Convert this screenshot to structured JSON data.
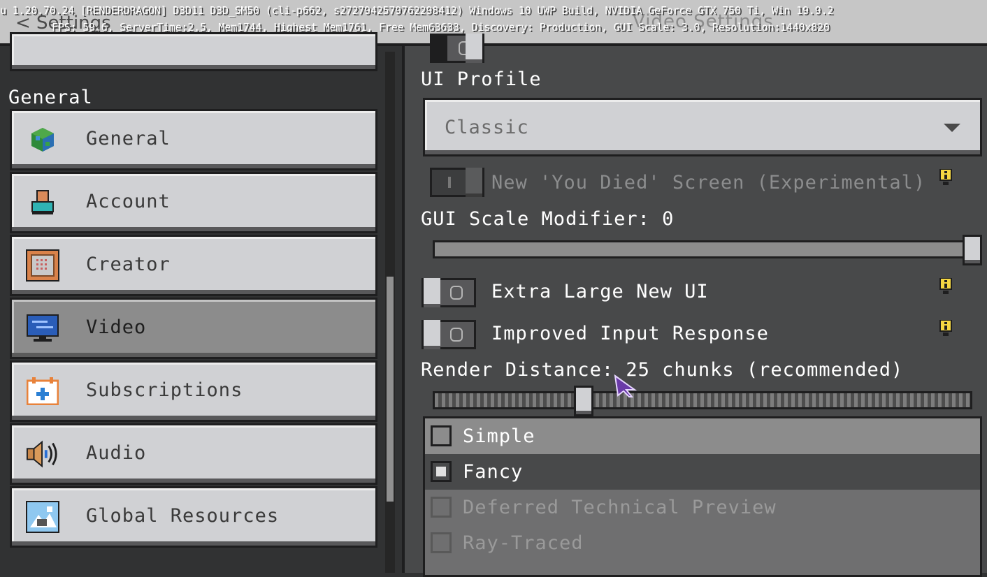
{
  "debug": {
    "line1": "u 1.20.70.24 [RENDERDRAGON] D3D11 D3D_SM50 (cli-p662, s2727942579762298412) Windows 10 UWP Build, NVIDIA GeForce GTX 750 Ti, Win 19.9.2",
    "line2": "FPS: 59.6, ServerTime:2.5, Mem1744, Highest Mem1761, Free Mem63633, Discovery: Production, GUI Scale: 3.0, Resolution:1440x820"
  },
  "header": {
    "back_label": "< Settings",
    "title": "Video Settings"
  },
  "sidebar": {
    "section_title": "General",
    "items": [
      {
        "label": "General",
        "icon": "globe-icon"
      },
      {
        "label": "Account",
        "icon": "account-icon"
      },
      {
        "label": "Creator",
        "icon": "command-block-icon"
      },
      {
        "label": "Video",
        "icon": "monitor-icon",
        "selected": true
      },
      {
        "label": "Subscriptions",
        "icon": "calendar-plus-icon"
      },
      {
        "label": "Audio",
        "icon": "speaker-icon"
      },
      {
        "label": "Global Resources",
        "icon": "resource-pack-icon"
      }
    ]
  },
  "content": {
    "ui_profile_label": "UI Profile",
    "ui_profile_value": "Classic",
    "you_died_label": "New 'You Died' Screen (Experimental)",
    "gui_scale_label": "GUI Scale Modifier: 0",
    "gui_scale_value": 0,
    "extra_large_label": "Extra Large New UI",
    "improved_input_label": "Improved Input Response",
    "render_distance_label": "Render Distance: 25 chunks (recommended)",
    "render_distance_value": 25,
    "graphics_options": [
      {
        "label": "Simple",
        "checked": false,
        "enabled": true
      },
      {
        "label": "Fancy",
        "checked": true,
        "enabled": true
      },
      {
        "label": "Deferred Technical Preview",
        "checked": false,
        "enabled": false
      },
      {
        "label": "Ray-Traced",
        "checked": false,
        "enabled": false
      }
    ]
  },
  "colors": {
    "background": "#313233",
    "panel": "#48494a",
    "button": "#d0d1d4",
    "selected_button": "#8c8c8c",
    "info_yellow": "#f5d742"
  }
}
